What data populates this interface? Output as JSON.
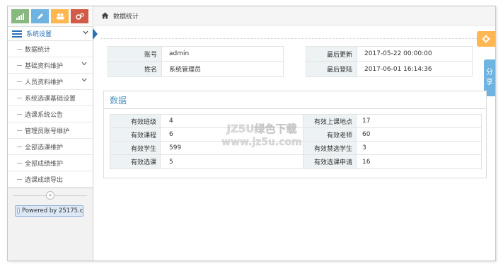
{
  "sidebar": {
    "menu_title": "系统设置",
    "items": [
      {
        "label": "数据统计",
        "has_children": false
      },
      {
        "label": "基础资料维护",
        "has_children": true
      },
      {
        "label": "人员资料维护",
        "has_children": true
      },
      {
        "label": "系统选课基础设置",
        "has_children": false
      },
      {
        "label": "选课系统公告",
        "has_children": false
      },
      {
        "label": "管理员账号维护",
        "has_children": false
      },
      {
        "label": "全部选课维护",
        "has_children": false
      },
      {
        "label": "全部成绩维护",
        "has_children": false
      },
      {
        "label": "选课成绩导出",
        "has_children": false
      }
    ],
    "collapse_glyph": "«",
    "powered_by": "Powered by 25175.c",
    "shortcut_icons": [
      "signal-icon",
      "pencil-icon",
      "users-icon",
      "cogs-icon"
    ]
  },
  "breadcrumb": {
    "title": "数据统计"
  },
  "floating": {
    "share_chars": [
      "分",
      "享"
    ]
  },
  "account_info": {
    "left": [
      {
        "label": "账号",
        "value": "admin"
      },
      {
        "label": "姓名",
        "value": "系统管理员"
      }
    ],
    "right": [
      {
        "label": "最后更新",
        "value": "2017-05-22 00:00:00"
      },
      {
        "label": "最后登陆",
        "value": "2017-06-01 16:14:36"
      }
    ]
  },
  "data_panel": {
    "title": "数据",
    "rows": [
      {
        "label1": "有效班级",
        "value1": "4",
        "label2": "有效上课地点",
        "value2": "17"
      },
      {
        "label1": "有效课程",
        "value1": "6",
        "label2": "有效老师",
        "value2": "60"
      },
      {
        "label1": "有效学生",
        "value1": "599",
        "label2": "有效禁选学生",
        "value2": "3"
      },
      {
        "label1": "有效选课",
        "value1": "5",
        "label2": "有效选课申请",
        "value2": "16"
      }
    ]
  },
  "watermark": {
    "line1": "JZ5U绿色下载",
    "line2": "www.jz5u.com"
  },
  "colors": {
    "accent": "#2b6fb6",
    "green": "#87b87f",
    "blue": "#6fb3e0",
    "orange": "#ffb752",
    "red": "#d15b47"
  }
}
